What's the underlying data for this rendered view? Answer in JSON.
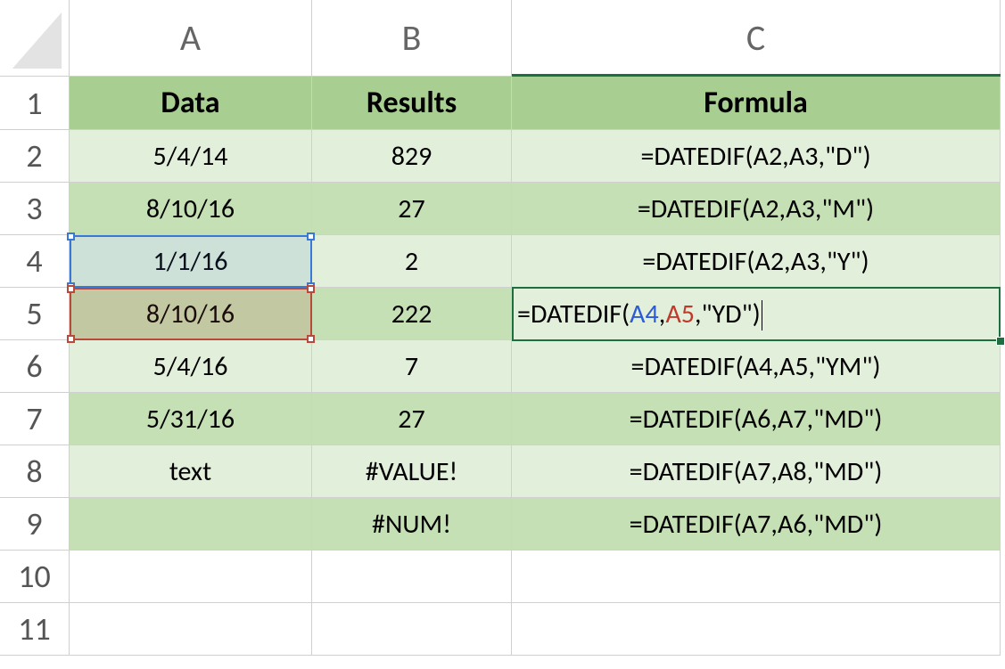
{
  "columns": {
    "a": "A",
    "b": "B",
    "c": "C"
  },
  "row_nums": {
    "r1": "1",
    "r2": "2",
    "r3": "3",
    "r4": "4",
    "r5": "5",
    "r6": "6",
    "r7": "7",
    "r8": "8",
    "r9": "9",
    "r10": "10",
    "r11": "11"
  },
  "header": {
    "a": "Data",
    "b": "Results",
    "c": "Formula"
  },
  "rows": {
    "r2": {
      "a": "5/4/14",
      "b": "829",
      "c": "=DATEDIF(A2,A3,\"D\")"
    },
    "r3": {
      "a": "8/10/16",
      "b": "27",
      "c": "=DATEDIF(A2,A3,\"M\")"
    },
    "r4": {
      "a": "1/1/16",
      "b": "2",
      "c": "=DATEDIF(A2,A3,\"Y\")"
    },
    "r5": {
      "a": "8/10/16",
      "b": "222",
      "c": "=DATEDIF(A4,A5,\"YD\")"
    },
    "r6": {
      "a": "5/4/16",
      "b": "7",
      "c": "=DATEDIF(A4,A5,\"YM\")"
    },
    "r7": {
      "a": "5/31/16",
      "b": "27",
      "c": "=DATEDIF(A6,A7,\"MD\")"
    },
    "r8": {
      "a": "text",
      "b": "#VALUE!",
      "c": "=DATEDIF(A7,A8,\"MD\")"
    },
    "r9": {
      "a": "",
      "b": "#NUM!",
      "c": "=DATEDIF(A7,A6,\"MD\")"
    }
  },
  "edit": {
    "prefix": "=DATEDIF(",
    "ref1": "A4",
    "sep1": ",",
    "ref2": "A5",
    "suffix": ",\"YD\")"
  },
  "chart_data": {
    "type": "table",
    "columns": [
      "Data",
      "Results",
      "Formula"
    ],
    "rows": [
      [
        "5/4/14",
        "829",
        "=DATEDIF(A2,A3,\"D\")"
      ],
      [
        "8/10/16",
        "27",
        "=DATEDIF(A2,A3,\"M\")"
      ],
      [
        "1/1/16",
        "2",
        "=DATEDIF(A2,A3,\"Y\")"
      ],
      [
        "8/10/16",
        "222",
        "=DATEDIF(A4,A5,\"YD\")"
      ],
      [
        "5/4/16",
        "7",
        "=DATEDIF(A4,A5,\"YM\")"
      ],
      [
        "5/31/16",
        "27",
        "=DATEDIF(A6,A7,\"MD\")"
      ],
      [
        "text",
        "#VALUE!",
        "=DATEDIF(A7,A8,\"MD\")"
      ],
      [
        "",
        "#NUM!",
        "=DATEDIF(A7,A6,\"MD\")"
      ]
    ]
  }
}
